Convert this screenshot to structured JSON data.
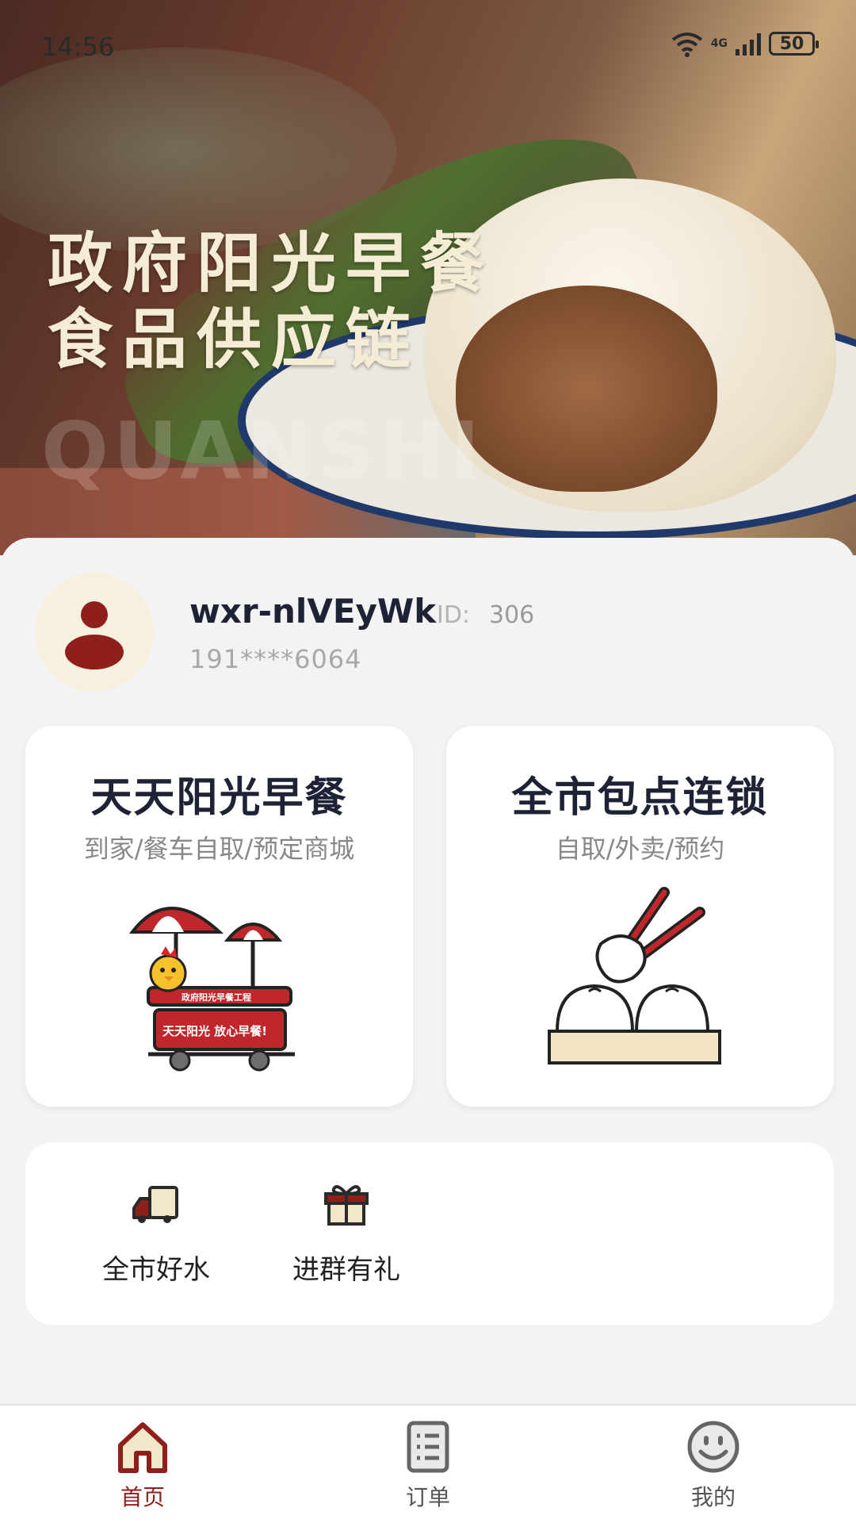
{
  "status_bar": {
    "time": "14:56",
    "network": "4G",
    "battery": "50"
  },
  "banner": {
    "title_line1": "政府阳光早餐",
    "title_line2": "食品供应链",
    "watermark": "QUANSHI"
  },
  "profile": {
    "username": "wxr-nlVEyWk",
    "id_label": "ID:",
    "id_value": "306",
    "phone": "191****6064"
  },
  "cards": [
    {
      "title": "天天阳光早餐",
      "subtitle": "到家/餐车自取/预定商城",
      "illustration_text1": "政府阳光早餐工程",
      "illustration_text2": "天天阳光 放心早餐!"
    },
    {
      "title": "全市包点连锁",
      "subtitle": "自取/外卖/预约"
    }
  ],
  "shortcuts": [
    {
      "label": "全市好水",
      "icon": "delivery-truck-icon"
    },
    {
      "label": "进群有礼",
      "icon": "gift-icon"
    }
  ],
  "tabs": [
    {
      "label": "首页",
      "icon": "home-icon",
      "active": true
    },
    {
      "label": "订单",
      "icon": "order-list-icon",
      "active": false
    },
    {
      "label": "我的",
      "icon": "smiley-icon",
      "active": false
    }
  ],
  "colors": {
    "accent": "#8f1f1b",
    "cream": "#f8f0df",
    "text_dark": "#1e2235"
  }
}
